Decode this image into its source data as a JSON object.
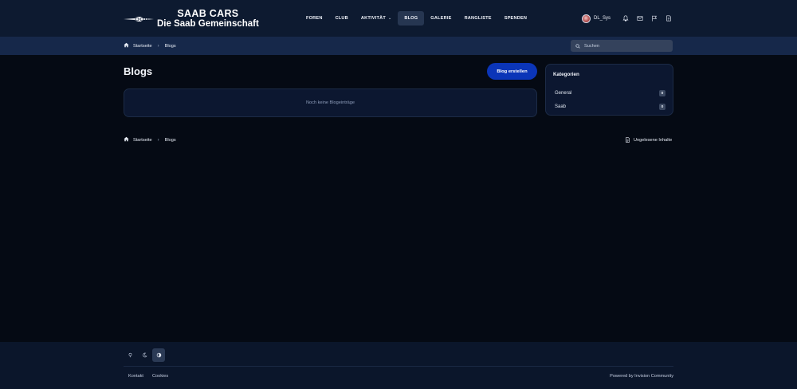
{
  "header": {
    "logo": {
      "line1": "SAAB CARS",
      "line2": "Die Saab Gemeinschaft"
    },
    "nav": [
      {
        "label": "FOREN",
        "active": false
      },
      {
        "label": "CLUB",
        "active": false
      },
      {
        "label": "AKTIVITÄT",
        "active": false,
        "has_dropdown": true
      },
      {
        "label": "BLOG",
        "active": true
      },
      {
        "label": "GALERIE",
        "active": false
      },
      {
        "label": "RANGLISTE",
        "active": false
      },
      {
        "label": "SPENDEN",
        "active": false
      }
    ],
    "username": "DL_Sys",
    "icons": [
      "bell-icon",
      "envelope-icon",
      "flag-icon",
      "document-icon"
    ]
  },
  "breadcrumb": {
    "home": "Startseite",
    "current": "Blogs"
  },
  "search": {
    "placeholder": "Suchen"
  },
  "main": {
    "title": "Blogs",
    "create_button": "Blog erstellen",
    "empty_message": "Noch keine Blogeinträge"
  },
  "categories": {
    "title": "Kategorien",
    "items": [
      {
        "label": "General",
        "count": "0"
      },
      {
        "label": "Saab",
        "count": "0"
      }
    ]
  },
  "footer_breadcrumb": {
    "home": "Startseite",
    "current": "Blogs",
    "unread": "Ungelesene Inhalte"
  },
  "footer": {
    "theme_icons": [
      "light-mode-icon",
      "dark-mode-icon",
      "auto-theme-icon"
    ],
    "links": [
      "Kontakt",
      "Cookies"
    ],
    "powered_by": "Powered by Invision Community"
  },
  "colors": {
    "background": "#050a14",
    "header": "#0d1a30",
    "breadcrumb_bar": "#16284a",
    "accent_button": "#0b35b8",
    "card": "#0c1730"
  }
}
